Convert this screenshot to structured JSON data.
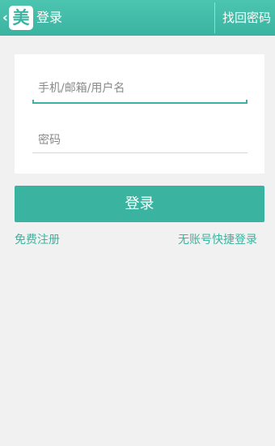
{
  "header": {
    "back_icon": "chevron-left-icon",
    "logo_text": "美",
    "title": "登录",
    "forgot_password": "找回密码"
  },
  "form": {
    "account_placeholder": "手机/邮箱/用户名",
    "password_placeholder": "密码"
  },
  "actions": {
    "login_label": "登录",
    "register_label": "免费注册",
    "quick_login_label": "无账号快捷登录"
  },
  "colors": {
    "accent": "#3ab4a0",
    "background": "#f1f1f1",
    "card": "#ffffff"
  }
}
